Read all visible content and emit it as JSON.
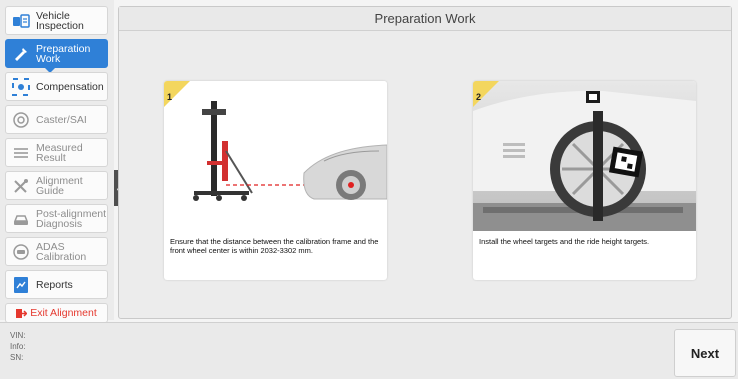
{
  "sidebar": {
    "items": [
      {
        "label": "Vehicle Inspection",
        "icon": "vehicle-inspection-icon",
        "state": "enabled"
      },
      {
        "label": "Preparation Work",
        "icon": "preparation-work-icon",
        "state": "active"
      },
      {
        "label": "Compensation",
        "icon": "compensation-icon",
        "state": "enabled"
      },
      {
        "label": "Caster/SAI",
        "icon": "caster-sai-icon",
        "state": "disabled"
      },
      {
        "label": "Measured Result",
        "icon": "measured-result-icon",
        "state": "disabled"
      },
      {
        "label": "Alignment Guide",
        "icon": "alignment-guide-icon",
        "state": "disabled"
      },
      {
        "label": "Post-alignment Diagnosis",
        "icon": "post-alignment-diagnosis-icon",
        "state": "disabled"
      },
      {
        "label": "ADAS Calibration",
        "icon": "adas-calibration-icon",
        "state": "disabled"
      },
      {
        "label": "Reports",
        "icon": "reports-icon",
        "state": "enabled"
      }
    ],
    "exit_label": "Exit Alignment"
  },
  "main": {
    "title": "Preparation Work",
    "steps": [
      {
        "number": "1",
        "caption": "Ensure that the distance between the calibration frame and the front wheel center is within 2032-3302 mm."
      },
      {
        "number": "2",
        "caption": "Install the wheel targets and the ride height targets."
      }
    ]
  },
  "footer": {
    "vin_label": "VIN:",
    "info_label": "Info:",
    "sn_label": "SN:",
    "next_label": "Next"
  },
  "colors": {
    "accent": "#2f80d7",
    "exit": "#e5382e",
    "step_badge": "#f3d65e",
    "laser": "#e02020"
  }
}
